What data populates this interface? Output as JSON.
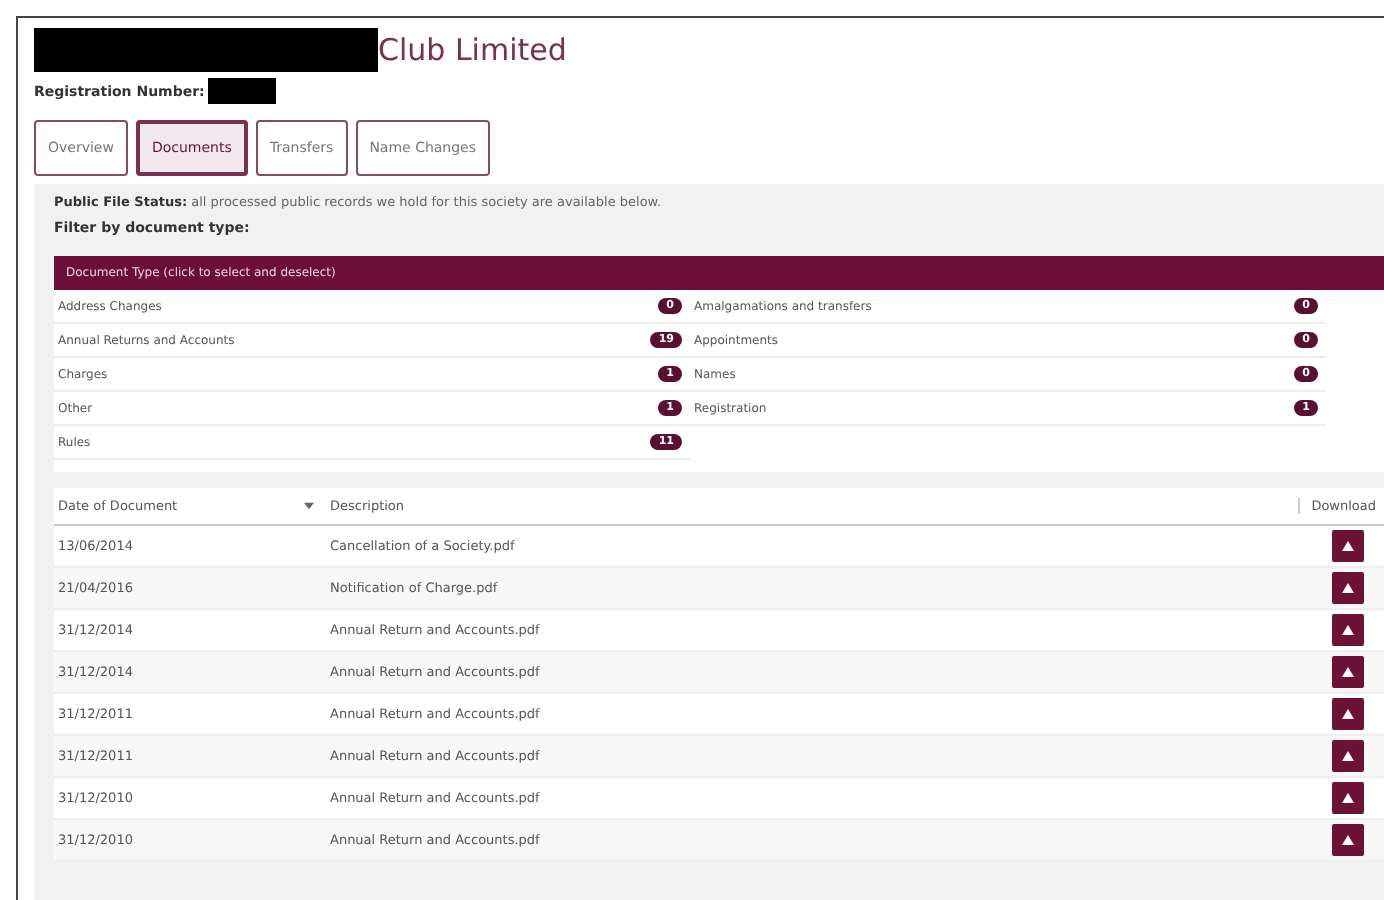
{
  "title": {
    "text": "Club Limited",
    "redacted": true
  },
  "registration": {
    "label": "Registration Number:",
    "redacted": true
  },
  "tabs": [
    {
      "label": "Overview",
      "selected": false
    },
    {
      "label": "Documents",
      "selected": true
    },
    {
      "label": "Transfers",
      "selected": false
    },
    {
      "label": "Name Changes",
      "selected": false
    }
  ],
  "status": {
    "label": "Public File Status:",
    "text": "all processed public records we hold for this society are available below."
  },
  "filter_label": "Filter by document type:",
  "filter": {
    "header": "Document Type (click to select and deselect)",
    "columns": [
      [
        {
          "label": "Address Changes",
          "count": "0"
        },
        {
          "label": "Annual Returns and Accounts",
          "count": "19"
        },
        {
          "label": "Charges",
          "count": "1"
        },
        {
          "label": "Other",
          "count": "1"
        },
        {
          "label": "Rules",
          "count": "11"
        }
      ],
      [
        {
          "label": "Amalgamations and transfers",
          "count": "0"
        },
        {
          "label": "Appointments",
          "count": "0"
        },
        {
          "label": "Names",
          "count": "0"
        },
        {
          "label": "Registration",
          "count": "1"
        }
      ]
    ]
  },
  "table": {
    "columns": [
      "Date of Document",
      "Description",
      "Download"
    ],
    "rows": [
      {
        "date": "13/06/2014",
        "description": "Cancellation of a Society.pdf"
      },
      {
        "date": "21/04/2016",
        "description": "Notification of Charge.pdf"
      },
      {
        "date": "31/12/2014",
        "description": "Annual Return and Accounts.pdf"
      },
      {
        "date": "31/12/2014",
        "description": "Annual Return and Accounts.pdf"
      },
      {
        "date": "31/12/2011",
        "description": "Annual Return and Accounts.pdf"
      },
      {
        "date": "31/12/2011",
        "description": "Annual Return and Accounts.pdf"
      },
      {
        "date": "31/12/2010",
        "description": "Annual Return and Accounts.pdf"
      },
      {
        "date": "31/12/2010",
        "description": "Annual Return and Accounts.pdf"
      }
    ]
  }
}
